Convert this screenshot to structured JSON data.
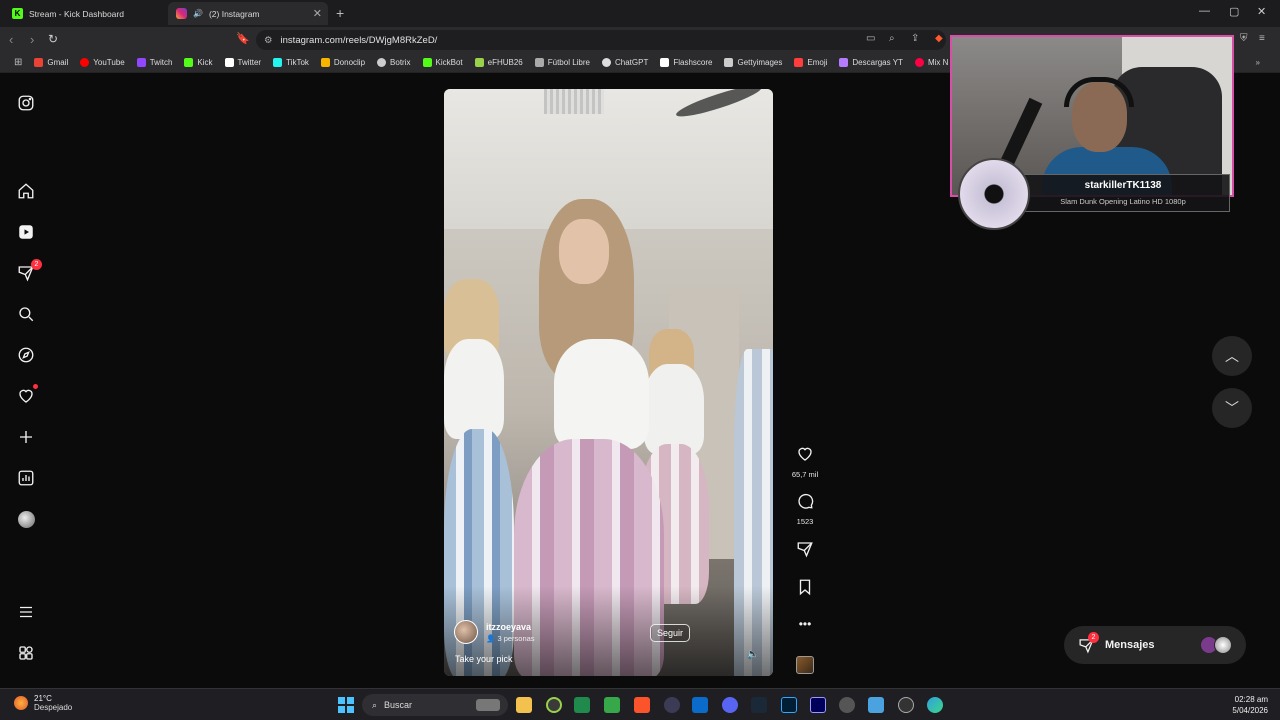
{
  "browser": {
    "tabs": [
      {
        "title": "Stream - Kick Dashboard"
      },
      {
        "title": "(2) Instagram"
      }
    ],
    "url": "instagram.com/reels/DWjgM8RkZeD/",
    "bookmarks": [
      {
        "label": "Gmail",
        "color": "#ea4335"
      },
      {
        "label": "YouTube",
        "color": "#ff0000"
      },
      {
        "label": "Twitch",
        "color": "#9146ff"
      },
      {
        "label": "Kick",
        "color": "#53fc18"
      },
      {
        "label": "Twitter",
        "color": "#ffffff"
      },
      {
        "label": "TikTok",
        "color": "#25f4ee"
      },
      {
        "label": "Donoclip",
        "color": "#f7b500"
      },
      {
        "label": "Botrix",
        "color": "#cccccc"
      },
      {
        "label": "KickBot",
        "color": "#53fc18"
      },
      {
        "label": "eFHUB26",
        "color": "#9ad14b"
      },
      {
        "label": "Fútbol Libre",
        "color": "#aaaaaa"
      },
      {
        "label": "ChatGPT",
        "color": "#dddddd"
      },
      {
        "label": "Flashscore",
        "color": "#ffffff"
      },
      {
        "label": "Gettyimages",
        "color": "#cccccc"
      },
      {
        "label": "Emoji",
        "color": "#ff3d3d"
      },
      {
        "label": "Descargas YT",
        "color": "#b57bff"
      },
      {
        "label": "Mix N",
        "color": "#ff0044"
      }
    ]
  },
  "reel": {
    "username": "itzzoeyava",
    "audience": "3 personas",
    "follow_label": "Seguir",
    "caption": "Take your pick"
  },
  "actions": {
    "likes": "65,7 mil",
    "comments": "1523"
  },
  "overlay": {
    "streamer": "starkillerTK1138",
    "song": "Slam Dunk Opening Latino HD 1080p"
  },
  "messages": {
    "label": "Mensajes",
    "badge": "2"
  },
  "nav": {
    "reels_badge": "2"
  },
  "taskbar": {
    "temperature": "21°C",
    "weather": "Despejado",
    "search_placeholder": "Buscar",
    "time": "02:28 am",
    "date": "5/04/2026"
  },
  "colors": {
    "accent_red": "#ff3040",
    "overlay_border": "#d94fa8"
  }
}
